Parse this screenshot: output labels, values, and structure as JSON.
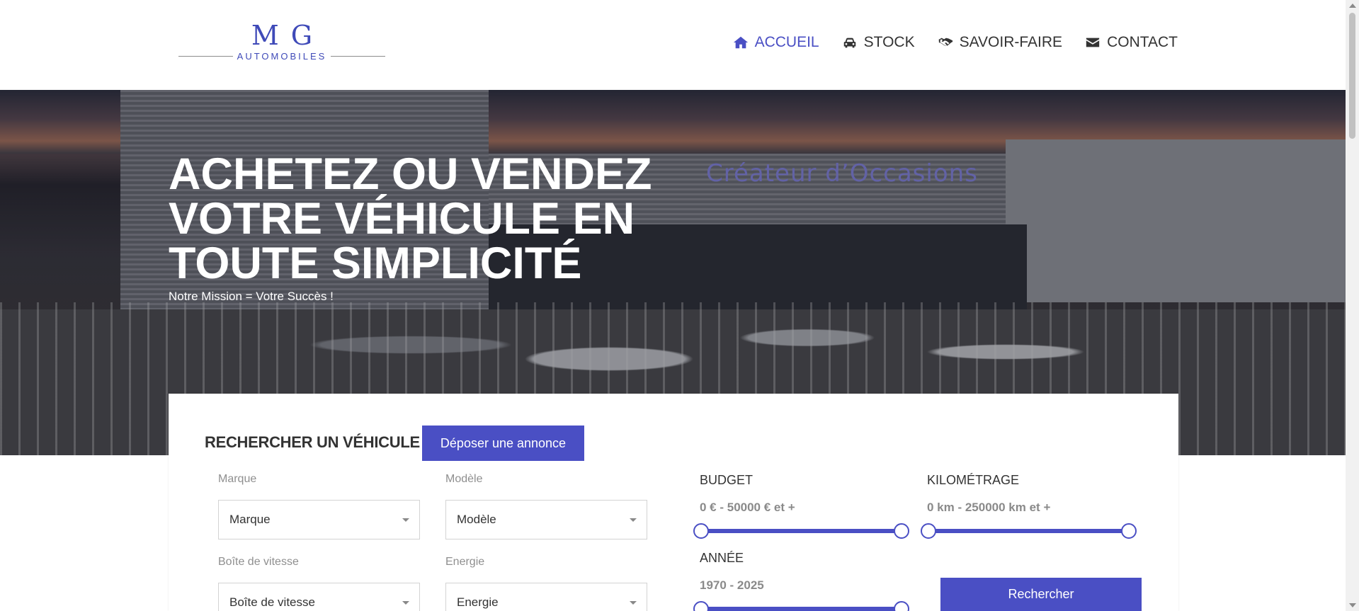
{
  "logo": {
    "mark": "MG",
    "subtitle": "AUTOMOBILES"
  },
  "nav": {
    "items": [
      {
        "label": "ACCUEIL",
        "icon": "home-icon",
        "active": true
      },
      {
        "label": "STOCK",
        "icon": "car-icon",
        "active": false
      },
      {
        "label": "SAVOIR-FAIRE",
        "icon": "handshake-icon",
        "active": false
      },
      {
        "label": "CONTACT",
        "icon": "envelope-icon",
        "active": false
      }
    ]
  },
  "hero": {
    "title_lines": [
      "ACHETEZ OU VENDEZ",
      "VOTRE VÉHICULE EN",
      "TOUTE SIMPLICITÉ"
    ],
    "subtitle": "Notre Mission = Votre Succès !",
    "sign_text": "Créateur d’Occasions"
  },
  "search": {
    "title": "RECHERCHER UN VÉHICULE",
    "deposit_button": "Déposer une annonce",
    "fields": {
      "marque": {
        "label": "Marque",
        "value": "Marque"
      },
      "modele": {
        "label": "Modèle",
        "value": "Modèle"
      },
      "boite": {
        "label": "Boîte de vitesse",
        "value": "Boîte de vitesse"
      },
      "energie": {
        "label": "Energie",
        "value": "Energie"
      }
    },
    "ranges": {
      "budget": {
        "label": "BUDGET",
        "value": "0 € - 50000 € et +",
        "min_fraction": 0,
        "max_fraction": 1
      },
      "kilometrage": {
        "label": "KILOMÉTRAGE",
        "value": "0 km - 250000 km et +",
        "min_fraction": 0,
        "max_fraction": 1
      },
      "annee": {
        "label": "ANNÉE",
        "value": "1970 - 2025",
        "min_fraction": 0,
        "max_fraction": 1
      }
    },
    "search_button": "Rechercher"
  },
  "colors": {
    "accent": "#4a4fc4",
    "text": "#333333",
    "muted": "#8f8f8f"
  }
}
